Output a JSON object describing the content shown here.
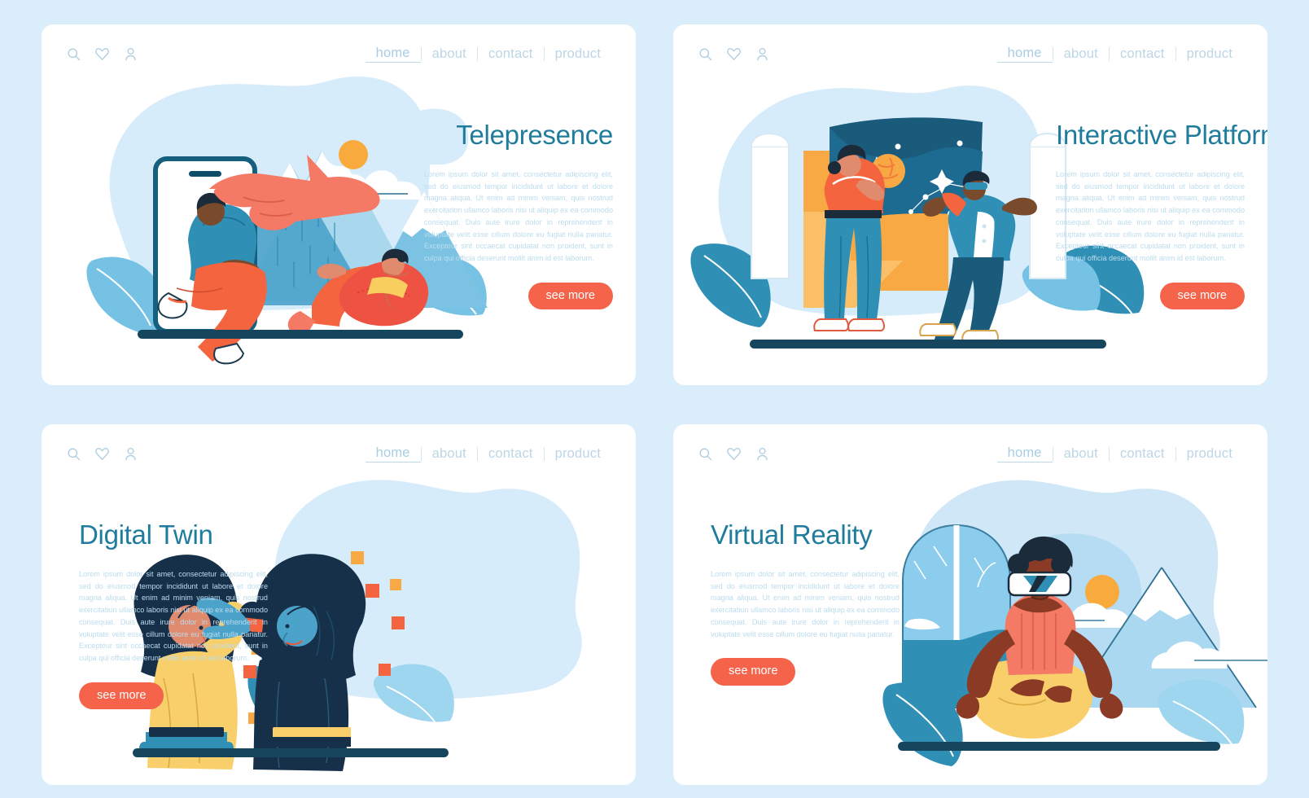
{
  "page": {
    "background_color": "#d9edfa",
    "card_background": "#ffffff",
    "accent_color": "#f4634a",
    "title_color": "#1f7c9c",
    "body_text_color": "#bcdcee",
    "nav_color": "#bcd6e6"
  },
  "nav": {
    "icons": [
      "search-icon",
      "heart-icon",
      "user-icon"
    ],
    "links": [
      {
        "label": "home",
        "active": true
      },
      {
        "label": "about",
        "active": false
      },
      {
        "label": "contact",
        "active": false
      },
      {
        "label": "product",
        "active": false
      }
    ]
  },
  "cards": [
    {
      "id": "telepresence",
      "title": "Telepresence",
      "body": "Lorem ipsum dolor sit amet, consectetur adipiscing elit, sed do eiusmod tempor incididunt ut labore et dolore magna aliqua. Ut enim ad minim veniam, quis nostrud exercitation ullamco laboris nisi ut aliquip ex ea commodo consequat. Duis aute irure dolor in reprehenderit in voluptate velit esse cillum dolore eu fugiat nulla pariatur. Excepteur sint occaecat cupidatat non proident, sunt in culpa qui officia deserunt mollit anim id est laborum.",
      "button": "see more",
      "text_side": "right",
      "illustration": "telepresence-illustration"
    },
    {
      "id": "interactive-platforms",
      "title": "Interactive Platforms",
      "body": "Lorem ipsum dolor sit amet, consectetur adipiscing elit, sed do eiusmod tempor incididunt ut labore et dolore magna aliqua. Ut enim ad minim veniam, quis nostrud exercitation ullamco laboris nisi ut aliquip ex ea commodo consequat. Duis aute irure dolor in reprehenderit in voluptate velit esse cillum dolore eu fugiat nulla pariatur. Excepteur sint occaecat cupidatat non proident, sunt in culpa qui officia deserunt mollit anim id est laborum.",
      "button": "see more",
      "text_side": "right",
      "illustration": "interactive-platforms-illustration"
    },
    {
      "id": "digital-twin",
      "title": "Digital Twin",
      "body": "Lorem ipsum dolor sit amet, consectetur adipiscing elit, sed do eiusmod tempor incididunt ut labore et dolore magna aliqua. Ut enim ad minim veniam, quis nostrud exercitation ullamco laboris nisi ut aliquip ex ea commodo consequat. Duis aute irure dolor in reprehenderit in voluptate velit esse cillum dolore eu fugiat nulla pariatur. Excepteur sint occaecat cupidatat non proident, sunt in culpa qui officia deserunt mollit anim id est laborum.",
      "button": "see more",
      "text_side": "left",
      "illustration": "digital-twin-illustration"
    },
    {
      "id": "virtual-reality",
      "title": "Virtual Reality",
      "body": "Lorem ipsum dolor sit amet, consectetur adipiscing elit, sed do eiusmod tempor incididunt ut labore et dolore magna aliqua. Ut enim ad minim veniam, quis nostrud exercitation ullamco laboris nisi ut aliquip ex ea commodo consequat. Duis aute irure dolor in reprehenderit in voluptate velit esse cillum dolore eu fugiat nulla pariatur.",
      "button": "see more",
      "text_side": "left",
      "illustration": "virtual-reality-illustration"
    }
  ]
}
